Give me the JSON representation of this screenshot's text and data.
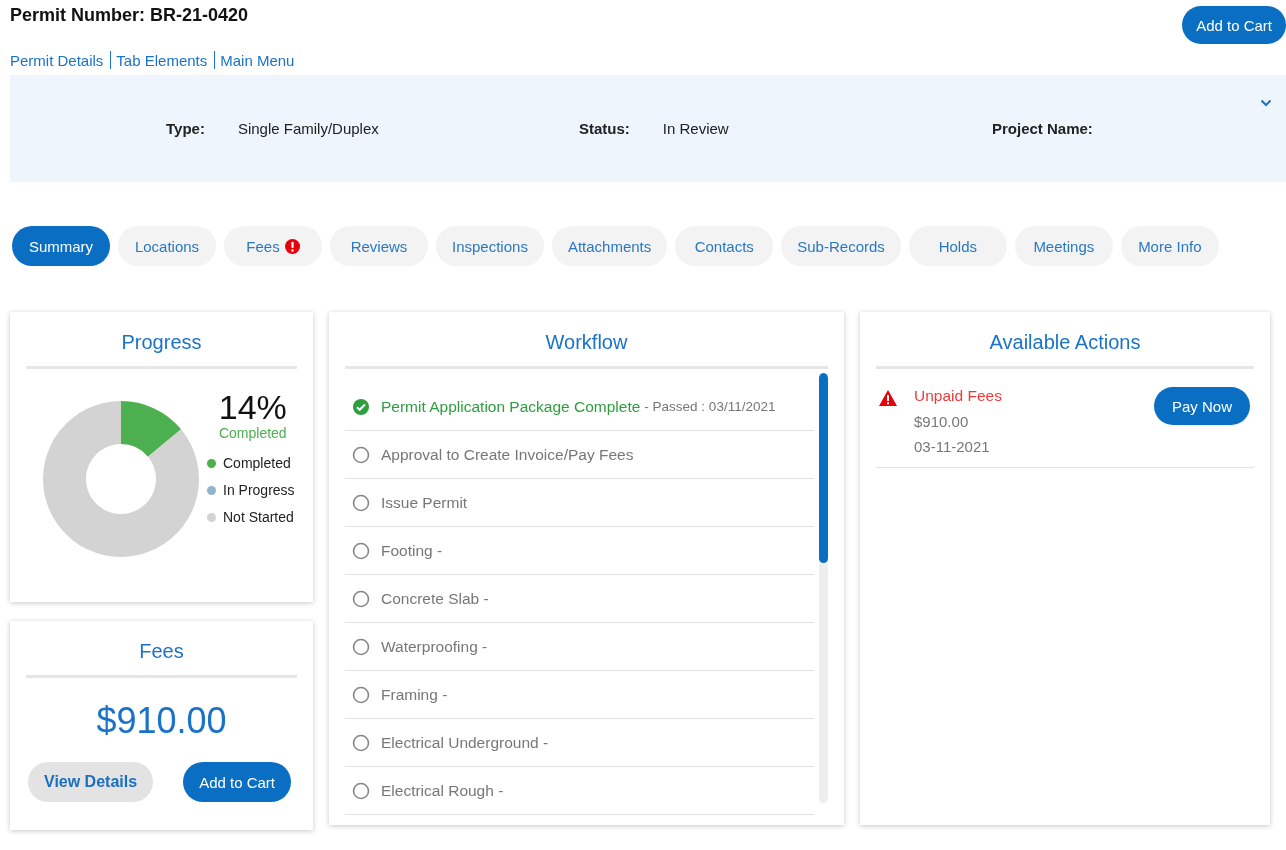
{
  "header": {
    "title": "Permit Number: BR-21-0420",
    "cart_button": "Add to Cart"
  },
  "links": [
    "Permit Details",
    "Tab Elements",
    "Main Menu"
  ],
  "info": {
    "expanded": true,
    "fields": [
      {
        "label": "Type:",
        "value": "Single Family/Duplex"
      },
      {
        "label": "Status:",
        "value": "In Review"
      },
      {
        "label": "Project Name:"
      }
    ]
  },
  "tabs": [
    {
      "label": "Summary",
      "selected": true,
      "alert": false
    },
    {
      "label": "Locations",
      "selected": false,
      "alert": false
    },
    {
      "label": "Fees",
      "selected": false,
      "alert": true
    },
    {
      "label": "Reviews",
      "selected": false,
      "alert": false
    },
    {
      "label": "Inspections",
      "selected": false,
      "alert": false
    },
    {
      "label": "Attachments",
      "selected": false,
      "alert": false
    },
    {
      "label": "Contacts",
      "selected": false,
      "alert": false
    },
    {
      "label": "Sub-Records",
      "selected": false,
      "alert": false
    },
    {
      "label": "Holds",
      "selected": false,
      "alert": false
    },
    {
      "label": "Meetings",
      "selected": false,
      "alert": false
    },
    {
      "label": "More Info",
      "selected": false,
      "alert": false
    }
  ],
  "progress": {
    "title": "Progress",
    "percent": "14%",
    "percent_label": "Completed",
    "chart_data": {
      "type": "donut",
      "categories": [
        "Completed",
        "In Progress",
        "Not Started"
      ],
      "values": [
        14,
        0,
        86
      ],
      "legend": "right",
      "colors": [
        "#4caf50",
        "#90b4cc",
        "#d3d3d3"
      ]
    }
  },
  "fees": {
    "title": "Fees",
    "amount": "$910.00",
    "details_button": "View Details",
    "cart_button": "Add to Cart"
  },
  "workflow": {
    "title": "Workflow",
    "steps": [
      {
        "label": "Permit Application Package Complete",
        "note": "- Passed : 03/11/2021",
        "completed": true
      },
      {
        "label": "Approval to Create Invoice/Pay Fees",
        "completed": false
      },
      {
        "label": "Issue Permit",
        "completed": false
      },
      {
        "label": "Footing -",
        "completed": false
      },
      {
        "label": "Concrete Slab -",
        "completed": false
      },
      {
        "label": "Waterproofing -",
        "completed": false
      },
      {
        "label": "Framing -",
        "completed": false
      },
      {
        "label": "Electrical Underground -",
        "completed": false
      },
      {
        "label": "Electrical Rough -",
        "completed": false
      }
    ]
  },
  "actions": {
    "title": "Available Actions",
    "items": [
      {
        "title": "Unpaid Fees",
        "amount": "$910.00",
        "date": "03-11-2021",
        "button": "Pay Now"
      }
    ]
  }
}
